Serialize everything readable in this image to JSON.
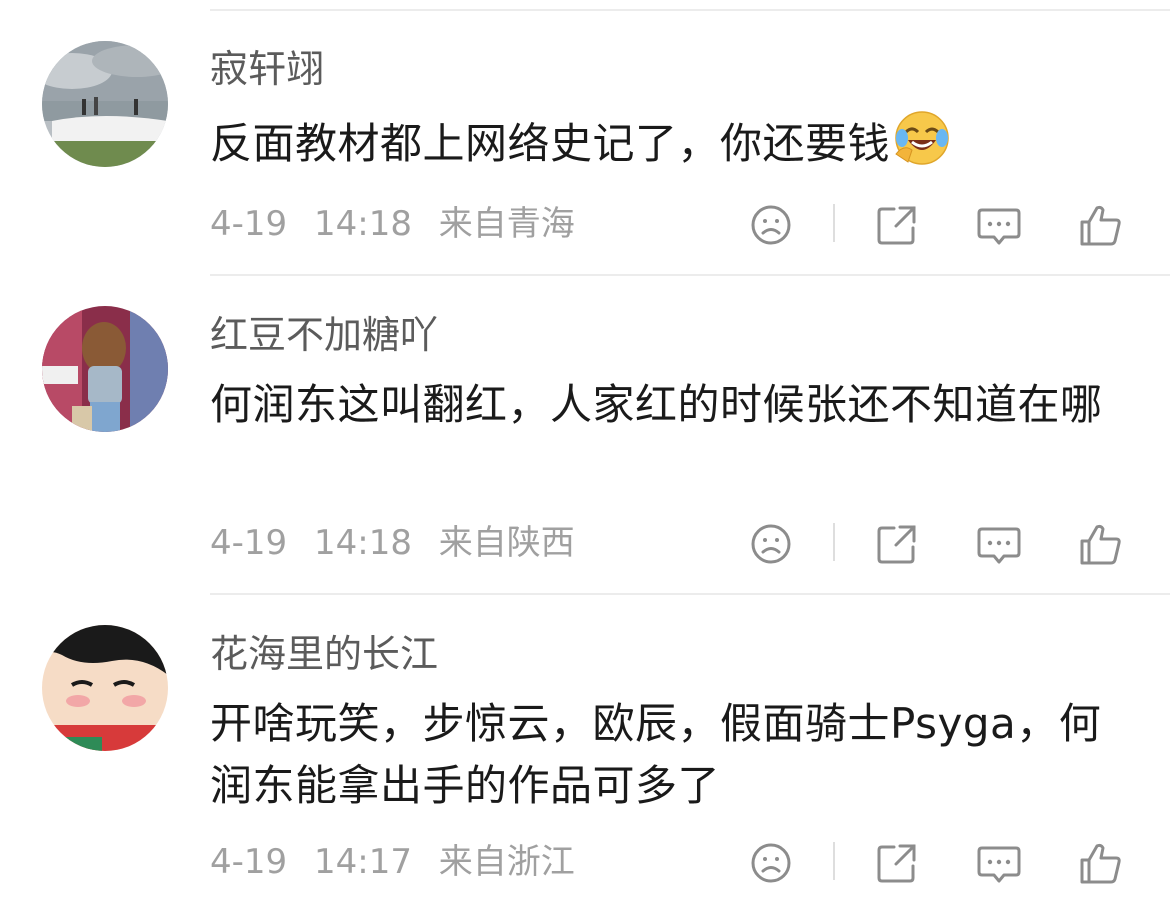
{
  "comments": [
    {
      "username": "寂轩翊",
      "text": "反面教材都上网络史记了，你还要钱",
      "emoji": "laughing-crying-emoji",
      "date": "4-19",
      "time": "14:18",
      "location": "来自青海"
    },
    {
      "username": "红豆不加糖吖",
      "text": "何润东这叫翻红，人家红的时候张还不知道在哪",
      "date": "4-19",
      "time": "14:18",
      "location": "来自陕西"
    },
    {
      "username": "花海里的长江",
      "text": "开啥玩笑，步惊云，欧辰，假面骑士Psyga，何润东能拿出手的作品可多了",
      "date": "4-19",
      "time": "14:17",
      "location": "来自浙江"
    }
  ],
  "action_icons": [
    "sad-face-icon",
    "share-icon",
    "comment-icon",
    "like-icon"
  ],
  "colors": {
    "text_primary": "#1a1a1a",
    "username": "#5b5b5b",
    "meta": "#a0a0a0",
    "icon": "#8c8c8c",
    "divider": "#ececec"
  }
}
